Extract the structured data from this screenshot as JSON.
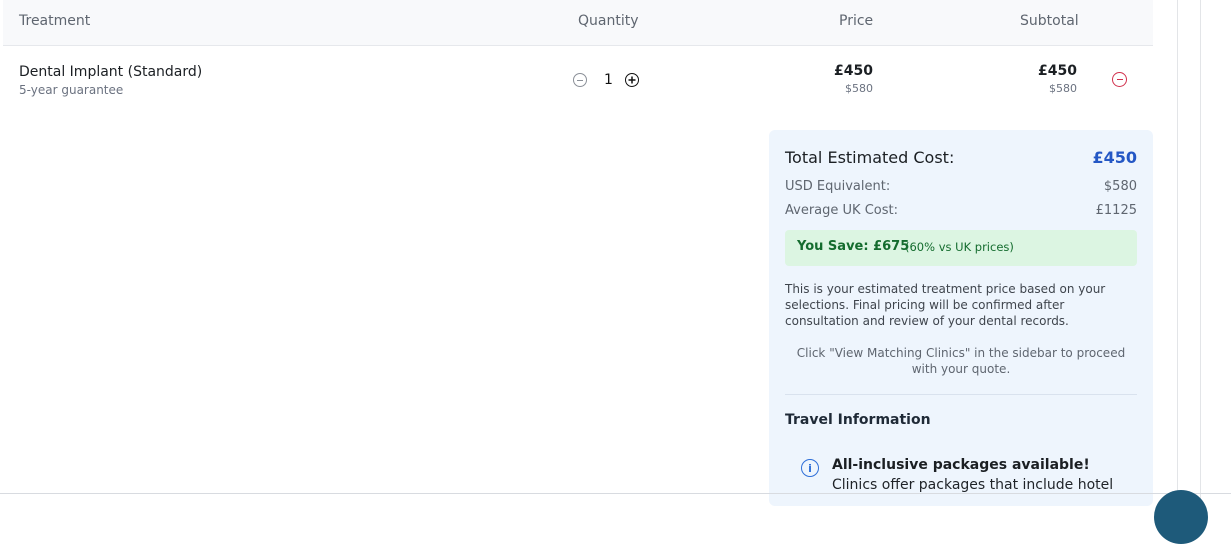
{
  "table": {
    "headers": {
      "treatment": "Treatment",
      "quantity": "Quantity",
      "price": "Price",
      "subtotal": "Subtotal"
    },
    "rows": [
      {
        "name": "Dental Implant (Standard)",
        "note": "5-year guarantee",
        "quantity": "1",
        "price_gbp": "£450",
        "price_usd": "$580",
        "subtotal_gbp": "£450",
        "subtotal_usd": "$580"
      }
    ]
  },
  "summary": {
    "total_label": "Total Estimated Cost:",
    "total_value": "£450",
    "usd_label": "USD Equivalent:",
    "usd_value": "$580",
    "uk_label": "Average UK Cost:",
    "uk_value": "£1125",
    "save_main": "You Save: £675",
    "save_sub": "(60% vs UK prices)",
    "disclaimer": "This is your estimated treatment price based on your selections. Final pricing will be confirmed after consultation and review of your dental records.",
    "cta": "Click \"View Matching Clinics\" in the sidebar to proceed with your quote.",
    "travel_title": "Travel Information",
    "info_bold": "All-inclusive packages available!",
    "info_text": " Clinics offer packages that include hotel"
  },
  "colors": {
    "accent_blue": "#2457c5",
    "save_green": "#146c2e",
    "remove_red": "#d1314d",
    "card_bg": "#eef5fd"
  },
  "icons": {
    "decrement": "minus-circle-icon",
    "increment": "plus-circle-icon",
    "remove": "remove-circle-icon",
    "info": "info-icon"
  }
}
